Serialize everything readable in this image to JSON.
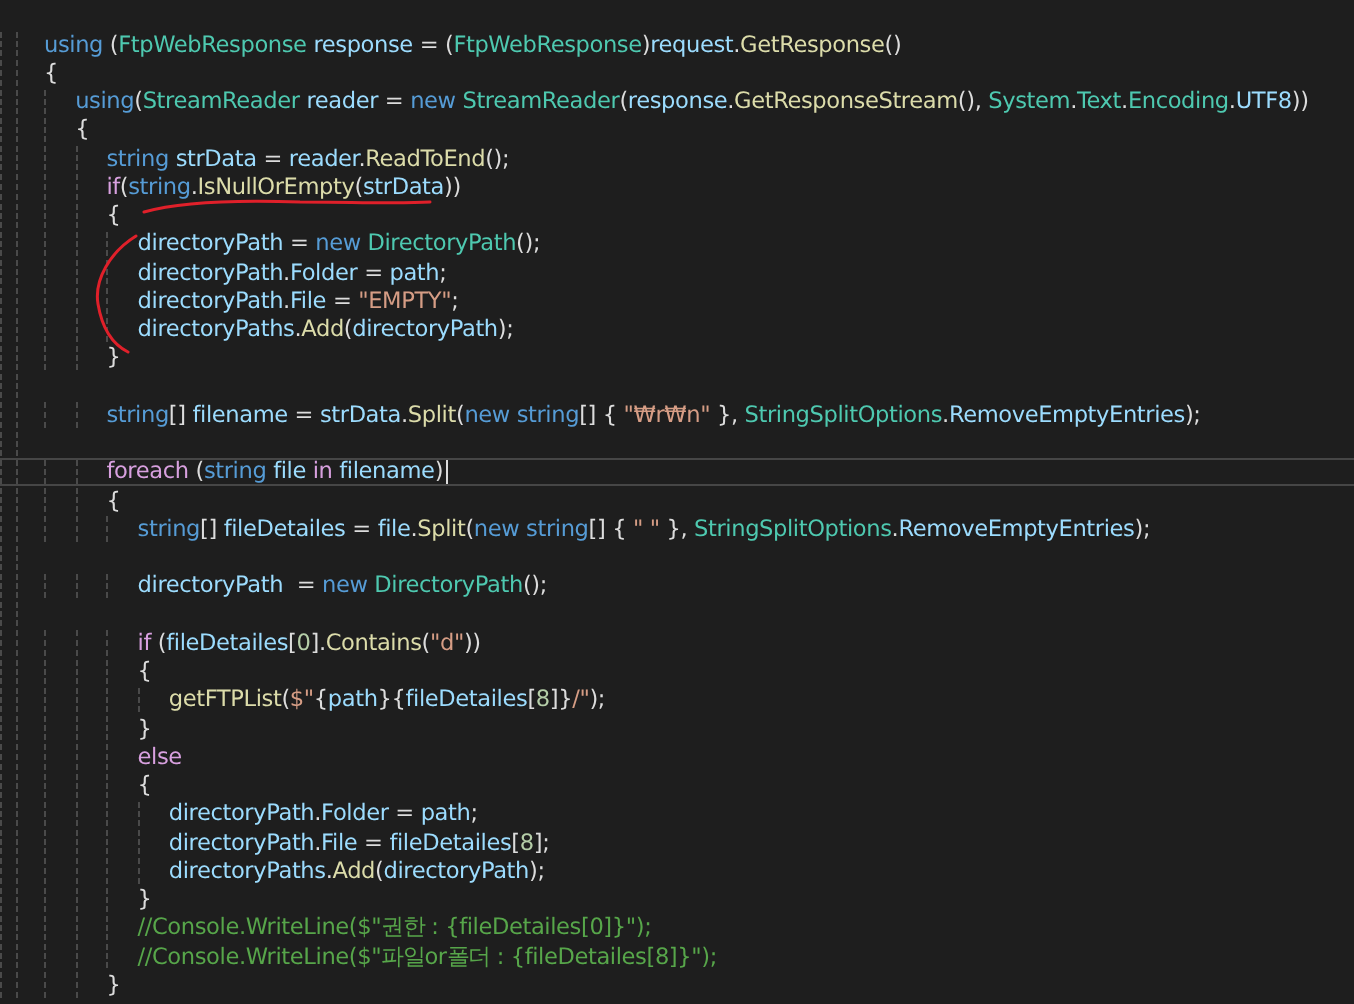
{
  "editor": {
    "lines": [
      {
        "kind": "code",
        "current": false,
        "tokens": [
          {
            "kind": "keyword",
            "text": "using"
          },
          {
            "kind": "plain",
            "text": " ("
          },
          {
            "kind": "type",
            "text": "FtpWebResponse"
          },
          {
            "kind": "variable",
            "text": " response"
          },
          {
            "kind": "plain",
            "text": " = ("
          },
          {
            "kind": "type",
            "text": "FtpWebResponse"
          },
          {
            "kind": "plain",
            "text": ")"
          },
          {
            "kind": "variable",
            "text": "request"
          },
          {
            "kind": "plain",
            "text": "."
          },
          {
            "kind": "method",
            "text": "GetResponse"
          },
          {
            "kind": "plain",
            "text": "()"
          }
        ]
      },
      {
        "kind": "code",
        "current": false,
        "tokens": [
          {
            "kind": "plain",
            "text": "{"
          }
        ]
      },
      {
        "kind": "code",
        "current": false,
        "tokens": [
          {
            "kind": "keyword",
            "text": "    using"
          },
          {
            "kind": "plain",
            "text": "("
          },
          {
            "kind": "type",
            "text": "StreamReader"
          },
          {
            "kind": "variable",
            "text": " reader"
          },
          {
            "kind": "plain",
            "text": " = "
          },
          {
            "kind": "keyword",
            "text": "new "
          },
          {
            "kind": "type",
            "text": "StreamReader"
          },
          {
            "kind": "plain",
            "text": "("
          },
          {
            "kind": "variable",
            "text": "response"
          },
          {
            "kind": "plain",
            "text": "."
          },
          {
            "kind": "method",
            "text": "GetResponseStream"
          },
          {
            "kind": "plain",
            "text": "(), "
          },
          {
            "kind": "type",
            "text": "System"
          },
          {
            "kind": "plain",
            "text": "."
          },
          {
            "kind": "type",
            "text": "Text"
          },
          {
            "kind": "plain",
            "text": "."
          },
          {
            "kind": "type",
            "text": "Encoding"
          },
          {
            "kind": "plain",
            "text": "."
          },
          {
            "kind": "variable",
            "text": "UTF8"
          },
          {
            "kind": "plain",
            "text": "))"
          }
        ]
      },
      {
        "kind": "code",
        "current": false,
        "tokens": [
          {
            "kind": "plain",
            "text": "    {"
          }
        ]
      },
      {
        "kind": "code",
        "current": false,
        "tokens": [
          {
            "kind": "keyword",
            "text": "        string"
          },
          {
            "kind": "variable",
            "text": " strData"
          },
          {
            "kind": "plain",
            "text": " = "
          },
          {
            "kind": "variable",
            "text": "reader"
          },
          {
            "kind": "plain",
            "text": "."
          },
          {
            "kind": "method",
            "text": "ReadToEnd"
          },
          {
            "kind": "plain",
            "text": "();"
          }
        ]
      },
      {
        "kind": "code",
        "current": false,
        "tokens": [
          {
            "kind": "control",
            "text": "        if"
          },
          {
            "kind": "plain",
            "text": "("
          },
          {
            "kind": "keyword",
            "text": "string"
          },
          {
            "kind": "plain",
            "text": "."
          },
          {
            "kind": "method",
            "text": "IsNullOrEmpty"
          },
          {
            "kind": "plain",
            "text": "("
          },
          {
            "kind": "variable",
            "text": "strData"
          },
          {
            "kind": "plain",
            "text": "))"
          }
        ]
      },
      {
        "kind": "code",
        "current": false,
        "tokens": [
          {
            "kind": "plain",
            "text": "        {"
          }
        ]
      },
      {
        "kind": "code",
        "current": false,
        "tokens": [
          {
            "kind": "variable",
            "text": "            directoryPath"
          },
          {
            "kind": "plain",
            "text": " = "
          },
          {
            "kind": "keyword",
            "text": "new "
          },
          {
            "kind": "type",
            "text": "DirectoryPath"
          },
          {
            "kind": "plain",
            "text": "();"
          }
        ]
      },
      {
        "kind": "code",
        "current": false,
        "tokens": [
          {
            "kind": "variable",
            "text": "            directoryPath"
          },
          {
            "kind": "plain",
            "text": "."
          },
          {
            "kind": "variable",
            "text": "Folder"
          },
          {
            "kind": "plain",
            "text": " = "
          },
          {
            "kind": "variable",
            "text": "path"
          },
          {
            "kind": "plain",
            "text": ";"
          }
        ]
      },
      {
        "kind": "code",
        "current": false,
        "tokens": [
          {
            "kind": "variable",
            "text": "            directoryPath"
          },
          {
            "kind": "plain",
            "text": "."
          },
          {
            "kind": "variable",
            "text": "File"
          },
          {
            "kind": "plain",
            "text": " = "
          },
          {
            "kind": "string",
            "text": "\"EMPTY\""
          },
          {
            "kind": "plain",
            "text": ";"
          }
        ]
      },
      {
        "kind": "code",
        "current": false,
        "tokens": [
          {
            "kind": "variable",
            "text": "            directoryPaths"
          },
          {
            "kind": "plain",
            "text": "."
          },
          {
            "kind": "method",
            "text": "Add"
          },
          {
            "kind": "plain",
            "text": "("
          },
          {
            "kind": "variable",
            "text": "directoryPath"
          },
          {
            "kind": "plain",
            "text": ");"
          }
        ]
      },
      {
        "kind": "code",
        "current": false,
        "tokens": [
          {
            "kind": "plain",
            "text": "        }"
          }
        ]
      },
      {
        "kind": "blank",
        "current": false
      },
      {
        "kind": "code",
        "current": false,
        "tokens": [
          {
            "kind": "keyword",
            "text": "        string"
          },
          {
            "kind": "plain",
            "text": "[] "
          },
          {
            "kind": "variable",
            "text": "filename"
          },
          {
            "kind": "plain",
            "text": " = "
          },
          {
            "kind": "variable",
            "text": "strData"
          },
          {
            "kind": "plain",
            "text": "."
          },
          {
            "kind": "method",
            "text": "Split"
          },
          {
            "kind": "plain",
            "text": "("
          },
          {
            "kind": "keyword",
            "text": "new string"
          },
          {
            "kind": "plain",
            "text": "[] { "
          },
          {
            "kind": "string",
            "text": "\"₩r₩n\""
          },
          {
            "kind": "plain",
            "text": " }, "
          },
          {
            "kind": "type",
            "text": "StringSplitOptions"
          },
          {
            "kind": "plain",
            "text": "."
          },
          {
            "kind": "variable",
            "text": "RemoveEmptyEntries"
          },
          {
            "kind": "plain",
            "text": ");"
          }
        ]
      },
      {
        "kind": "blank",
        "current": false
      },
      {
        "kind": "code",
        "current": true,
        "tokens": [
          {
            "kind": "control",
            "text": "        foreach"
          },
          {
            "kind": "plain",
            "text": " ("
          },
          {
            "kind": "keyword",
            "text": "string"
          },
          {
            "kind": "variable",
            "text": " file"
          },
          {
            "kind": "control",
            "text": " in"
          },
          {
            "kind": "variable",
            "text": " filename"
          },
          {
            "kind": "plain",
            "text": ")"
          }
        ]
      },
      {
        "kind": "code",
        "current": false,
        "tokens": [
          {
            "kind": "plain",
            "text": "        {"
          }
        ]
      },
      {
        "kind": "code",
        "current": false,
        "tokens": [
          {
            "kind": "keyword",
            "text": "            string"
          },
          {
            "kind": "plain",
            "text": "[] "
          },
          {
            "kind": "variable",
            "text": "fileDetailes"
          },
          {
            "kind": "plain",
            "text": " = "
          },
          {
            "kind": "variable",
            "text": "file"
          },
          {
            "kind": "plain",
            "text": "."
          },
          {
            "kind": "method",
            "text": "Split"
          },
          {
            "kind": "plain",
            "text": "("
          },
          {
            "kind": "keyword",
            "text": "new string"
          },
          {
            "kind": "plain",
            "text": "[] { "
          },
          {
            "kind": "string",
            "text": "\" \""
          },
          {
            "kind": "plain",
            "text": " }, "
          },
          {
            "kind": "type",
            "text": "StringSplitOptions"
          },
          {
            "kind": "plain",
            "text": "."
          },
          {
            "kind": "variable",
            "text": "RemoveEmptyEntries"
          },
          {
            "kind": "plain",
            "text": ");"
          }
        ]
      },
      {
        "kind": "blank",
        "current": false
      },
      {
        "kind": "code",
        "current": false,
        "tokens": [
          {
            "kind": "variable",
            "text": "            directoryPath"
          },
          {
            "kind": "plain",
            "text": "  = "
          },
          {
            "kind": "keyword",
            "text": "new "
          },
          {
            "kind": "type",
            "text": "DirectoryPath"
          },
          {
            "kind": "plain",
            "text": "();"
          }
        ]
      },
      {
        "kind": "blank",
        "current": false
      },
      {
        "kind": "code",
        "current": false,
        "tokens": [
          {
            "kind": "control",
            "text": "            if"
          },
          {
            "kind": "plain",
            "text": " ("
          },
          {
            "kind": "variable",
            "text": "fileDetailes"
          },
          {
            "kind": "plain",
            "text": "["
          },
          {
            "kind": "number",
            "text": "0"
          },
          {
            "kind": "plain",
            "text": "]."
          },
          {
            "kind": "method",
            "text": "Contains"
          },
          {
            "kind": "plain",
            "text": "("
          },
          {
            "kind": "string",
            "text": "\"d\""
          },
          {
            "kind": "plain",
            "text": "))"
          }
        ]
      },
      {
        "kind": "code",
        "current": false,
        "tokens": [
          {
            "kind": "plain",
            "text": "            {"
          }
        ]
      },
      {
        "kind": "code",
        "current": false,
        "tokens": [
          {
            "kind": "method",
            "text": "                getFTPList"
          },
          {
            "kind": "plain",
            "text": "("
          },
          {
            "kind": "string",
            "text": "$\""
          },
          {
            "kind": "plain",
            "text": "{"
          },
          {
            "kind": "variable",
            "text": "path"
          },
          {
            "kind": "plain",
            "text": "}{"
          },
          {
            "kind": "variable",
            "text": "fileDetailes"
          },
          {
            "kind": "plain",
            "text": "["
          },
          {
            "kind": "number",
            "text": "8"
          },
          {
            "kind": "plain",
            "text": "]}"
          },
          {
            "kind": "string",
            "text": "/\""
          },
          {
            "kind": "plain",
            "text": ");"
          }
        ]
      },
      {
        "kind": "code",
        "current": false,
        "tokens": [
          {
            "kind": "plain",
            "text": "            }"
          }
        ]
      },
      {
        "kind": "code",
        "current": false,
        "tokens": [
          {
            "kind": "control",
            "text": "            else"
          }
        ]
      },
      {
        "kind": "code",
        "current": false,
        "tokens": [
          {
            "kind": "plain",
            "text": "            {"
          }
        ]
      },
      {
        "kind": "code",
        "current": false,
        "tokens": [
          {
            "kind": "variable",
            "text": "                directoryPath"
          },
          {
            "kind": "plain",
            "text": "."
          },
          {
            "kind": "variable",
            "text": "Folder"
          },
          {
            "kind": "plain",
            "text": " = "
          },
          {
            "kind": "variable",
            "text": "path"
          },
          {
            "kind": "plain",
            "text": ";"
          }
        ]
      },
      {
        "kind": "code",
        "current": false,
        "tokens": [
          {
            "kind": "variable",
            "text": "                directoryPath"
          },
          {
            "kind": "plain",
            "text": "."
          },
          {
            "kind": "variable",
            "text": "File"
          },
          {
            "kind": "plain",
            "text": " = "
          },
          {
            "kind": "variable",
            "text": "fileDetailes"
          },
          {
            "kind": "plain",
            "text": "["
          },
          {
            "kind": "number",
            "text": "8"
          },
          {
            "kind": "plain",
            "text": "];"
          }
        ]
      },
      {
        "kind": "code",
        "current": false,
        "tokens": [
          {
            "kind": "variable",
            "text": "                directoryPaths"
          },
          {
            "kind": "plain",
            "text": "."
          },
          {
            "kind": "method",
            "text": "Add"
          },
          {
            "kind": "plain",
            "text": "("
          },
          {
            "kind": "variable",
            "text": "directoryPath"
          },
          {
            "kind": "plain",
            "text": ");"
          }
        ]
      },
      {
        "kind": "code",
        "current": false,
        "tokens": [
          {
            "kind": "plain",
            "text": "            }"
          }
        ]
      },
      {
        "kind": "code",
        "current": false,
        "tokens": [
          {
            "kind": "comment",
            "text": "            //Console.WriteLine($\"권한 : {fileDetailes[0]}\");"
          }
        ]
      },
      {
        "kind": "code",
        "current": false,
        "tokens": [
          {
            "kind": "comment",
            "text": "            //Console.WriteLine($\"파일or폴더 : {fileDetailes[8]}\");"
          }
        ]
      },
      {
        "kind": "code",
        "current": false,
        "tokens": [
          {
            "kind": "plain",
            "text": "        }"
          }
        ]
      }
    ]
  }
}
